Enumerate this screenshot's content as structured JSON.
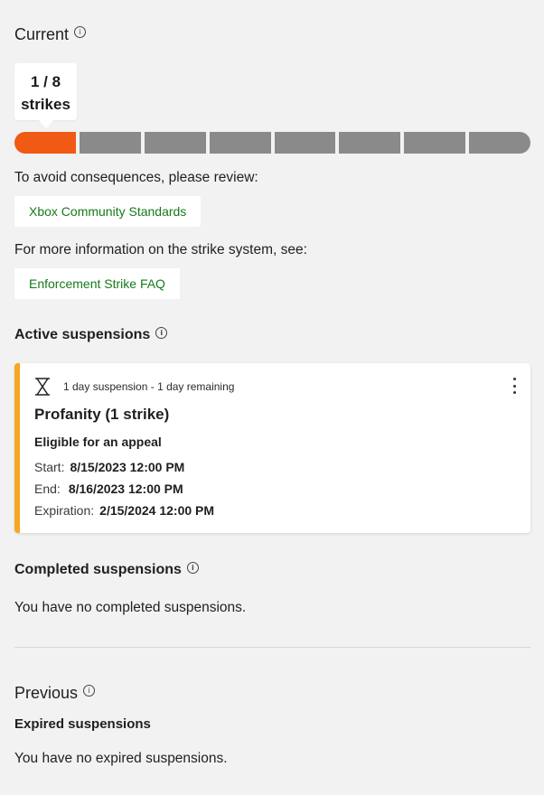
{
  "current": {
    "title": "Current",
    "strike_bubble": {
      "line1": "1 / 8",
      "line2": "strikes"
    },
    "strikes": {
      "count": 1,
      "total": 8
    },
    "colors": {
      "filled": "#f05a14",
      "empty": "#8a8a8a"
    },
    "avoid_text": "To avoid consequences, please review:",
    "standards_link": "Xbox Community Standards",
    "more_info_text": "For more information on the strike system, see:",
    "faq_link": "Enforcement Strike FAQ"
  },
  "active": {
    "title": "Active suspensions",
    "card": {
      "icon": "hourglass-icon",
      "duration_text": "1 day suspension - 1 day remaining",
      "title": "Profanity (1 strike)",
      "appeal": "Eligible for an appeal",
      "start_label": "Start:",
      "start_value": "8/15/2023 12:00 PM",
      "end_label": "End:",
      "end_value": "8/16/2023 12:00 PM",
      "expiration_label": "Expiration:",
      "expiration_value": "2/15/2024 12:00 PM",
      "accent_color": "#f6a623"
    }
  },
  "completed": {
    "title": "Completed suspensions",
    "empty_text": "You have no completed suspensions."
  },
  "previous": {
    "title": "Previous",
    "expired_title": "Expired suspensions",
    "empty_text": "You have no expired suspensions."
  },
  "info_glyph": "i"
}
